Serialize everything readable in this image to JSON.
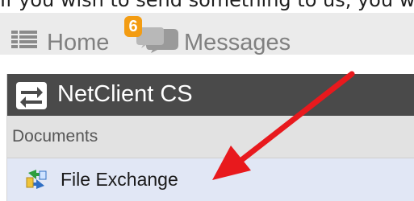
{
  "page": {
    "cutoff_text": "If you wish to send something to us, you w"
  },
  "topbar": {
    "home_label": "Home",
    "messages_badge": "6",
    "messages_label": "Messages"
  },
  "panel": {
    "title": "NetClient CS",
    "section": "Documents",
    "items": [
      {
        "label": "File Exchange",
        "icon": "file-exchange-icon"
      }
    ]
  },
  "colors": {
    "header_bg": "#4a4a4a",
    "topbar_bg": "#ebebeb",
    "section_bg": "#e2e2e2",
    "item_bg": "#e1e7f5",
    "badge": "#f39c12",
    "arrow": "#e8191d"
  },
  "icons": {
    "home": "grid-icon",
    "messages": "speech-bubble-icon",
    "panel": "exchange-arrows-icon"
  }
}
